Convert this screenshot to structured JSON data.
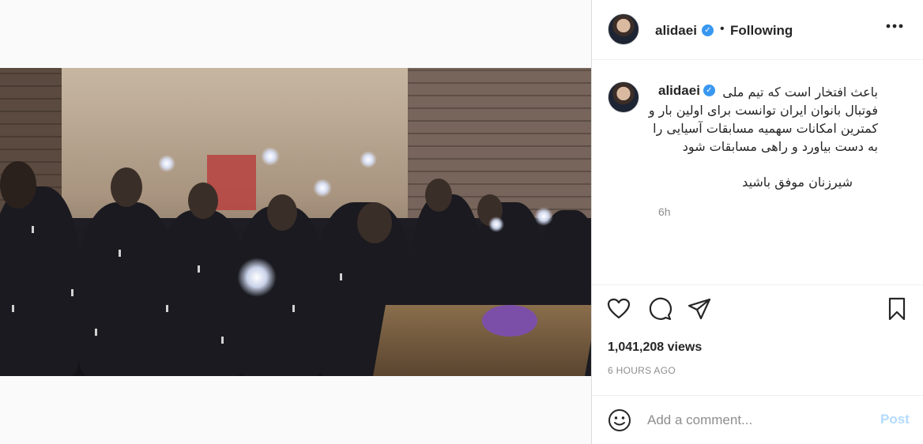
{
  "post": {
    "author": "alidaei",
    "follow_status": "Following",
    "separator": "•",
    "more_label": "•••",
    "verified_mark": "✓"
  },
  "caption": {
    "username": "alidaei",
    "text": "باعث افتخار است که تیم ملی\nفوتبال بانوان ایران توانست برای اولین بار و\nکمترین امکانات سهمیه مسابقات آسیایی را\nبه دست بیاورد و راهی مسابقات شود",
    "closing": "شیرزنان موفق باشید",
    "time": "6h"
  },
  "stats": {
    "views": "1,041,208 views",
    "posted": "6 HOURS AGO"
  },
  "comment": {
    "placeholder": "Add a comment...",
    "post_label": "Post"
  },
  "icons": {
    "like": "heart-icon",
    "comment": "comment-icon",
    "share": "share-icon",
    "save": "bookmark-icon",
    "emoji": "emoji-icon",
    "more": "more-icon",
    "verified": "verified-badge-icon"
  },
  "colors": {
    "verified": "#3897f0",
    "post_button_disabled": "#b3dbff",
    "muted_text": "#8e8e8e",
    "border": "#dbdbdb"
  }
}
